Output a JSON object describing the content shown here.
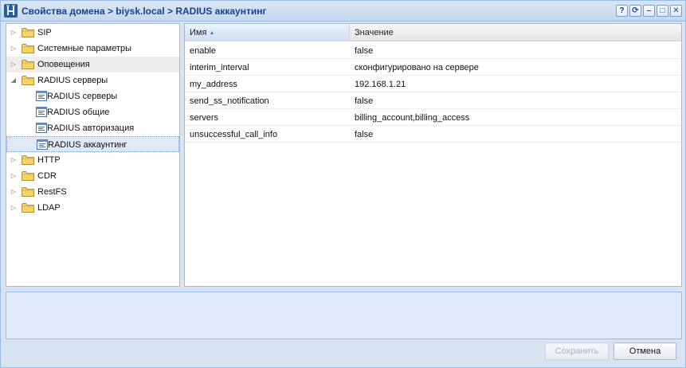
{
  "window": {
    "title": "Свойства домена > biysk.local > RADIUS аккаунтинг",
    "tools": [
      {
        "name": "help-tool",
        "glyph": "?"
      },
      {
        "name": "refresh-tool",
        "glyph": "⟳"
      },
      {
        "name": "minimize-tool",
        "glyph": "–"
      },
      {
        "name": "maximize-tool",
        "glyph": "□"
      },
      {
        "name": "close-tool",
        "glyph": "✕"
      }
    ]
  },
  "tree": {
    "items": [
      {
        "label": "SIP",
        "type": "folder",
        "state": "collapsed"
      },
      {
        "label": "Системные параметры",
        "type": "folder",
        "state": "collapsed"
      },
      {
        "label": "Оповещения",
        "type": "folder",
        "state": "collapsed",
        "hover": true
      },
      {
        "label": "RADIUS серверы",
        "type": "folder",
        "state": "expanded"
      },
      {
        "label": "RADIUS серверы",
        "type": "leaf"
      },
      {
        "label": "RADIUS общие",
        "type": "leaf"
      },
      {
        "label": "RADIUS авторизация",
        "type": "leaf"
      },
      {
        "label": "RADIUS аккаунтинг",
        "type": "leaf",
        "selected": true
      },
      {
        "label": "HTTP",
        "type": "folder",
        "state": "collapsed"
      },
      {
        "label": "CDR",
        "type": "folder",
        "state": "collapsed"
      },
      {
        "label": "RestFS",
        "type": "folder",
        "state": "collapsed"
      },
      {
        "label": "LDAP",
        "type": "folder",
        "state": "collapsed"
      }
    ]
  },
  "grid": {
    "columns": [
      {
        "label": "Имя",
        "sorted": "asc"
      },
      {
        "label": "Значение"
      }
    ],
    "rows": [
      {
        "name": "enable",
        "value": "false"
      },
      {
        "name": "interim_interval",
        "value": "сконфигурировано на сервере"
      },
      {
        "name": "my_address",
        "value": "192.168.1.21"
      },
      {
        "name": "send_ss_notification",
        "value": "false"
      },
      {
        "name": "servers",
        "value": "billing_account,billing_access"
      },
      {
        "name": "unsuccessful_call_info",
        "value": "false"
      }
    ]
  },
  "footer": {
    "save_label": "Сохранить",
    "cancel_label": "Отмена"
  },
  "colors": {
    "title_text": "#15428b",
    "border": "#99bbe8",
    "folder": "#f2c94c",
    "selected_row": "#dfe8f6"
  }
}
